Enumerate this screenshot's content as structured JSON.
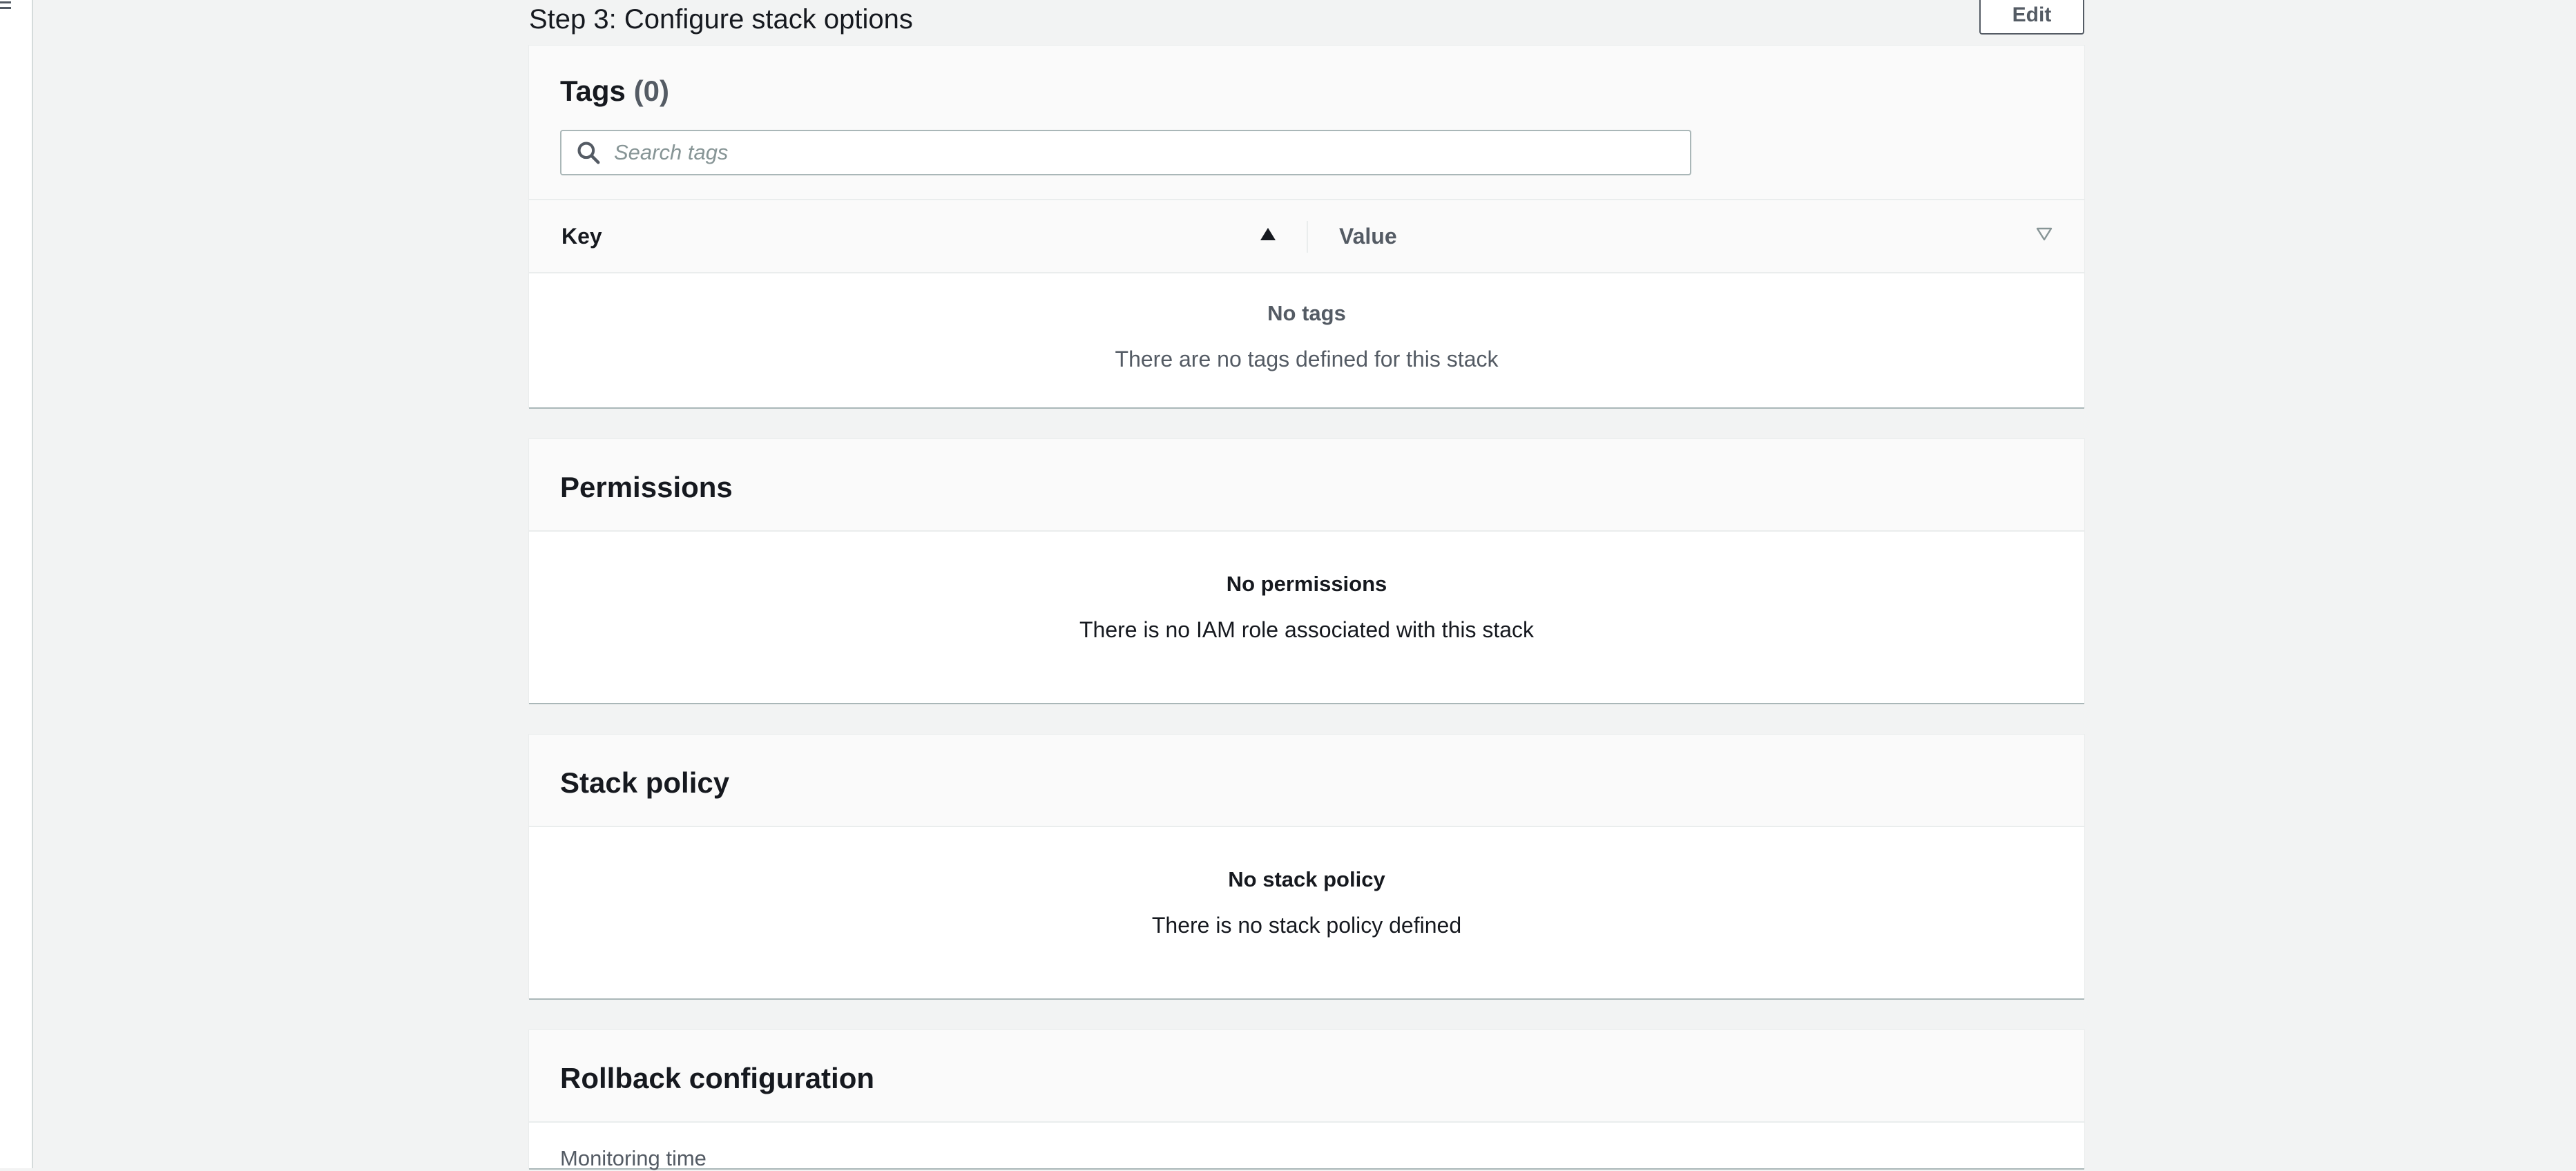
{
  "step": {
    "title": "Step 3: Configure stack options",
    "edit_label": "Edit"
  },
  "tags": {
    "title": "Tags",
    "count": "(0)",
    "search_placeholder": "Search tags",
    "columns": {
      "key": "Key",
      "value": "Value"
    },
    "empty_title": "No tags",
    "empty_desc": "There are no tags defined for this stack"
  },
  "permissions": {
    "title": "Permissions",
    "empty_title": "No permissions",
    "empty_desc": "There is no IAM role associated with this stack"
  },
  "stack_policy": {
    "title": "Stack policy",
    "empty_title": "No stack policy",
    "empty_desc": "There is no stack policy defined"
  },
  "rollback": {
    "title": "Rollback configuration",
    "monitoring_label": "Monitoring time"
  },
  "icons": {
    "menu": "hamburger-menu-icon",
    "search": "search-icon",
    "sort_asc": "sort-ascending-icon",
    "sort_desc": "sort-descending-icon"
  },
  "colors": {
    "background": "#f2f3f3",
    "panel": "#ffffff",
    "panel_header": "#fafafa",
    "text": "#16191f",
    "muted_text": "#545b64",
    "border": "#aab7b8"
  }
}
